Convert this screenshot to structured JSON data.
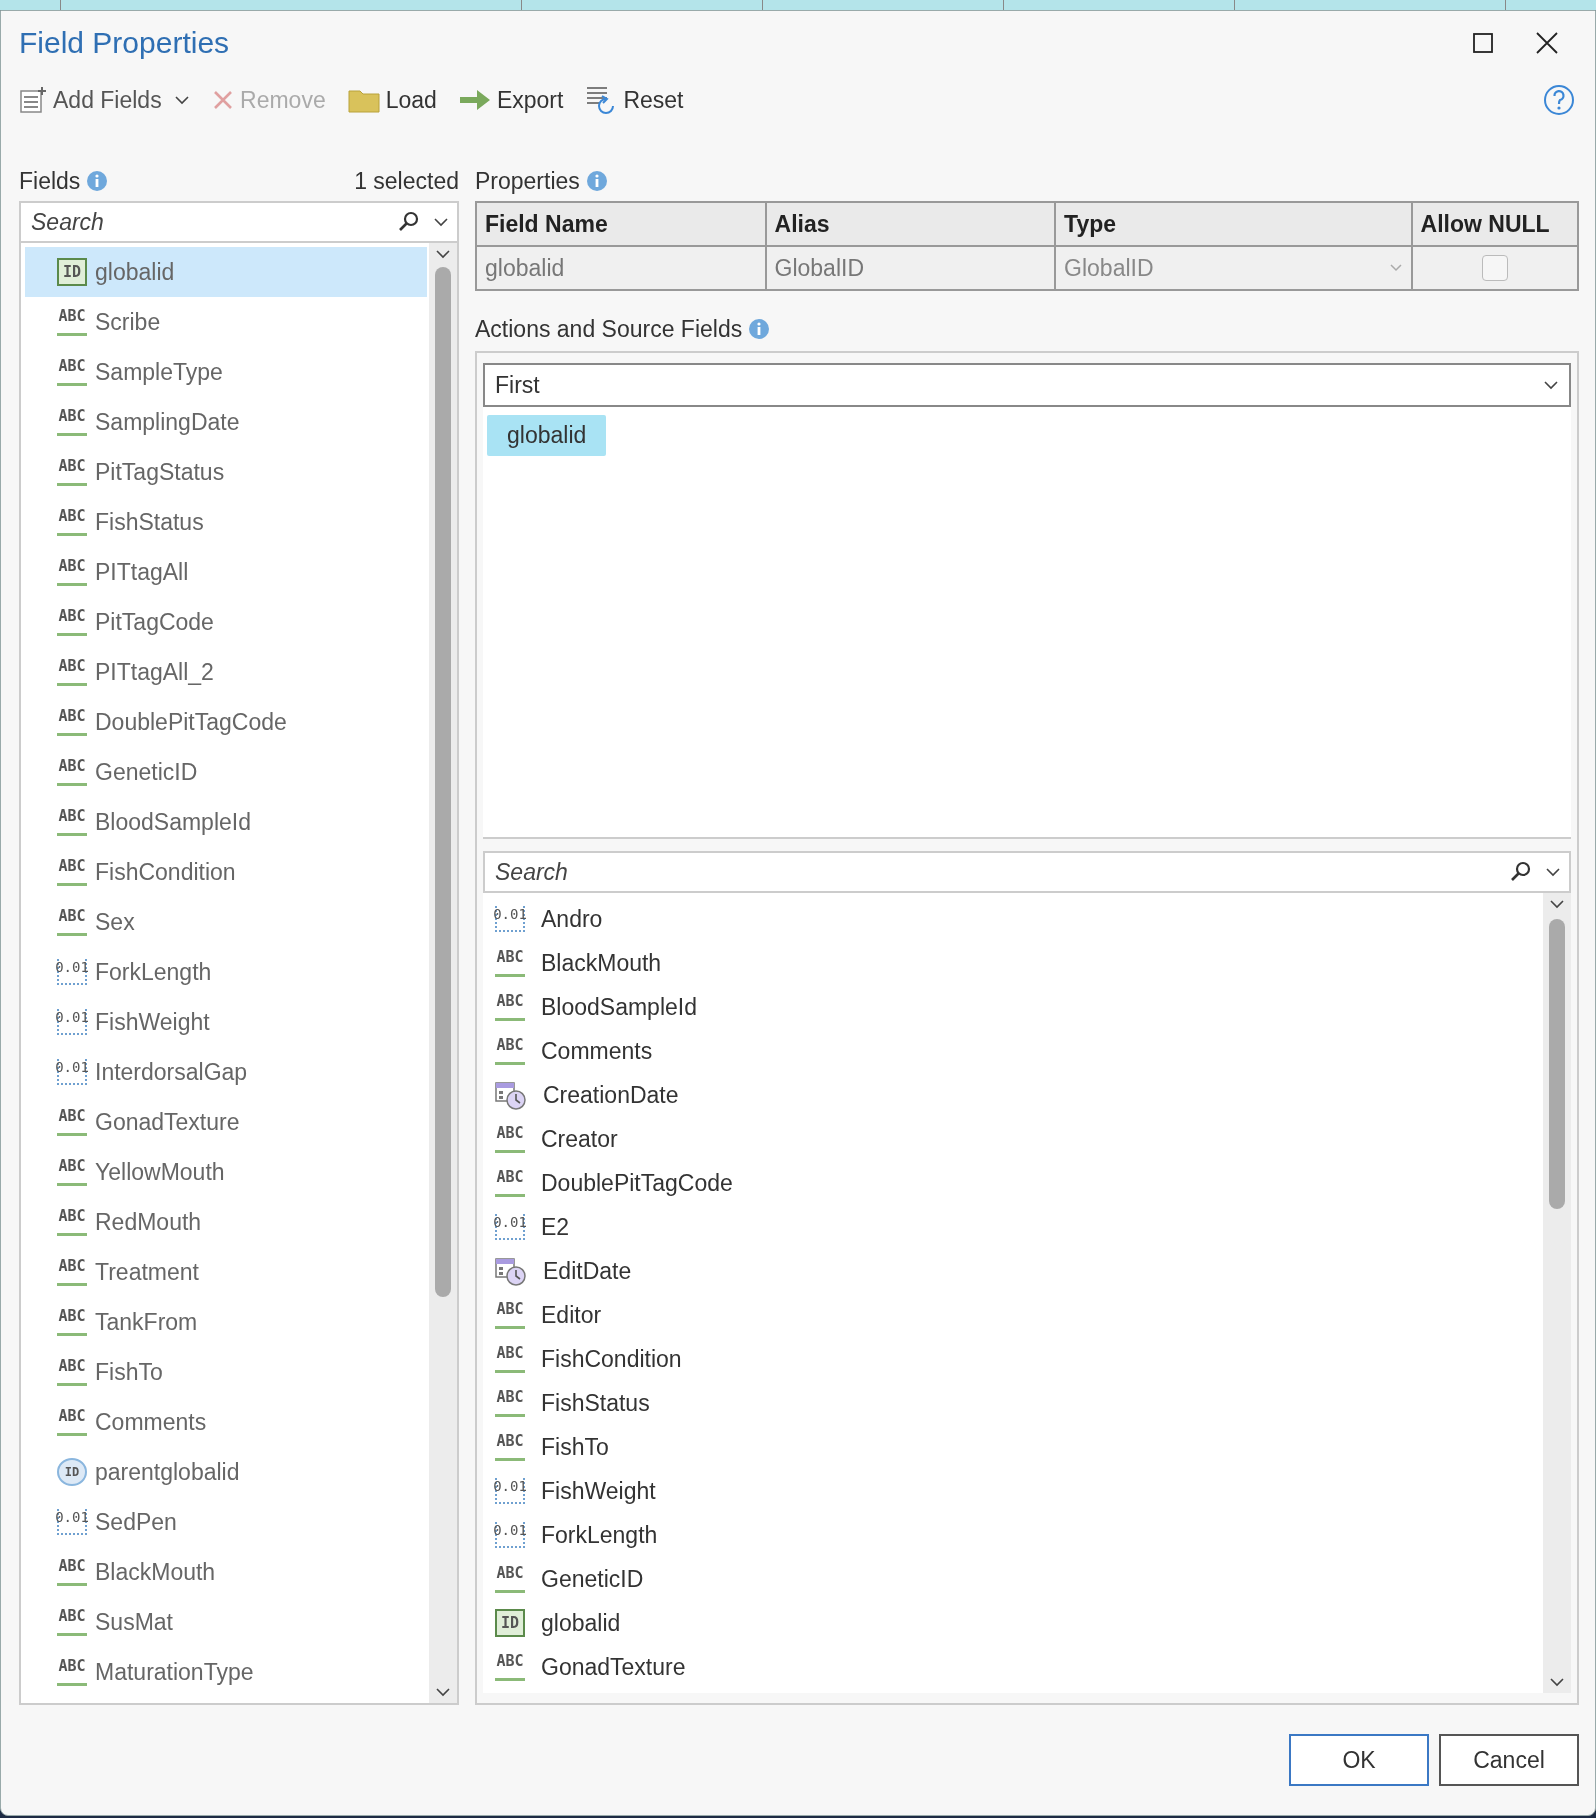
{
  "window": {
    "title": "Field Properties"
  },
  "toolbar": [
    {
      "label": "Add Fields",
      "kind": "add",
      "disabled": false,
      "dropdown": true
    },
    {
      "label": "Remove",
      "kind": "remove",
      "disabled": true,
      "dropdown": false
    },
    {
      "label": "Load",
      "kind": "load",
      "disabled": false,
      "dropdown": false
    },
    {
      "label": "Export",
      "kind": "export",
      "disabled": false,
      "dropdown": false
    },
    {
      "label": "Reset",
      "kind": "reset",
      "disabled": false,
      "dropdown": false
    }
  ],
  "fields_panel": {
    "title": "Fields",
    "count": "1 selected",
    "search": {
      "placeholder": "Search"
    },
    "items": [
      {
        "name": "globalid",
        "kind": "id",
        "icon_text": "ID",
        "selected": true
      },
      {
        "name": "Scribe",
        "kind": "text",
        "icon_text": "ABC",
        "selected": false
      },
      {
        "name": "SampleType",
        "kind": "text",
        "icon_text": "ABC",
        "selected": false
      },
      {
        "name": "SamplingDate",
        "kind": "text",
        "icon_text": "ABC",
        "selected": false
      },
      {
        "name": "PitTagStatus",
        "kind": "text",
        "icon_text": "ABC",
        "selected": false
      },
      {
        "name": "FishStatus",
        "kind": "text",
        "icon_text": "ABC",
        "selected": false
      },
      {
        "name": "PITtagAll",
        "kind": "text",
        "icon_text": "ABC",
        "selected": false
      },
      {
        "name": "PitTagCode",
        "kind": "text",
        "icon_text": "ABC",
        "selected": false
      },
      {
        "name": "PITtagAll_2",
        "kind": "text",
        "icon_text": "ABC",
        "selected": false
      },
      {
        "name": "DoublePitTagCode",
        "kind": "text",
        "icon_text": "ABC",
        "selected": false
      },
      {
        "name": "GeneticID",
        "kind": "text",
        "icon_text": "ABC",
        "selected": false
      },
      {
        "name": "BloodSampleId",
        "kind": "text",
        "icon_text": "ABC",
        "selected": false
      },
      {
        "name": "FishCondition",
        "kind": "text",
        "icon_text": "ABC",
        "selected": false
      },
      {
        "name": "Sex",
        "kind": "text",
        "icon_text": "ABC",
        "selected": false
      },
      {
        "name": "ForkLength",
        "kind": "number",
        "icon_text": "0.01",
        "selected": false
      },
      {
        "name": "FishWeight",
        "kind": "number",
        "icon_text": "0.01",
        "selected": false
      },
      {
        "name": "InterdorsalGap",
        "kind": "number",
        "icon_text": "0.01",
        "selected": false
      },
      {
        "name": "GonadTexture",
        "kind": "text",
        "icon_text": "ABC",
        "selected": false
      },
      {
        "name": "YellowMouth",
        "kind": "text",
        "icon_text": "ABC",
        "selected": false
      },
      {
        "name": "RedMouth",
        "kind": "text",
        "icon_text": "ABC",
        "selected": false
      },
      {
        "name": "Treatment",
        "kind": "text",
        "icon_text": "ABC",
        "selected": false
      },
      {
        "name": "TankFrom",
        "kind": "text",
        "icon_text": "ABC",
        "selected": false
      },
      {
        "name": "FishTo",
        "kind": "text",
        "icon_text": "ABC",
        "selected": false
      },
      {
        "name": "Comments",
        "kind": "text",
        "icon_text": "ABC",
        "selected": false
      },
      {
        "name": "parentglobalid",
        "kind": "guid",
        "icon_text": "ID",
        "selected": false
      },
      {
        "name": "SedPen",
        "kind": "number",
        "icon_text": "0.01",
        "selected": false
      },
      {
        "name": "BlackMouth",
        "kind": "text",
        "icon_text": "ABC",
        "selected": false
      },
      {
        "name": "SusMat",
        "kind": "text",
        "icon_text": "ABC",
        "selected": false
      },
      {
        "name": "MaturationType",
        "kind": "text",
        "icon_text": "ABC",
        "selected": false
      }
    ]
  },
  "properties": {
    "title": "Properties",
    "columns": [
      "Field Name",
      "Alias",
      "Type",
      "Allow NULL"
    ],
    "row": {
      "field_name": "globalid",
      "alias": "GlobalID",
      "type": "GlobalID",
      "allow_null": false,
      "disabled": true
    }
  },
  "actions": {
    "title": "Actions and Source Fields",
    "action": "First",
    "chips": [
      "globalid"
    ],
    "search": {
      "placeholder": "Search"
    },
    "source_fields": [
      {
        "name": "Andro",
        "kind": "number",
        "icon_text": "0.01"
      },
      {
        "name": "BlackMouth",
        "kind": "text",
        "icon_text": "ABC"
      },
      {
        "name": "BloodSampleId",
        "kind": "text",
        "icon_text": "ABC"
      },
      {
        "name": "Comments",
        "kind": "text",
        "icon_text": "ABC"
      },
      {
        "name": "CreationDate",
        "kind": "date"
      },
      {
        "name": "Creator",
        "kind": "text",
        "icon_text": "ABC"
      },
      {
        "name": "DoublePitTagCode",
        "kind": "text",
        "icon_text": "ABC"
      },
      {
        "name": "E2",
        "kind": "number",
        "icon_text": "0.01"
      },
      {
        "name": "EditDate",
        "kind": "date"
      },
      {
        "name": "Editor",
        "kind": "text",
        "icon_text": "ABC"
      },
      {
        "name": "FishCondition",
        "kind": "text",
        "icon_text": "ABC"
      },
      {
        "name": "FishStatus",
        "kind": "text",
        "icon_text": "ABC"
      },
      {
        "name": "FishTo",
        "kind": "text",
        "icon_text": "ABC"
      },
      {
        "name": "FishWeight",
        "kind": "number",
        "icon_text": "0.01"
      },
      {
        "name": "ForkLength",
        "kind": "number",
        "icon_text": "0.01"
      },
      {
        "name": "GeneticID",
        "kind": "text",
        "icon_text": "ABC"
      },
      {
        "name": "globalid",
        "kind": "id",
        "icon_text": "ID"
      },
      {
        "name": "GonadTexture",
        "kind": "text",
        "icon_text": "ABC"
      }
    ]
  },
  "buttons": [
    {
      "label": "OK",
      "default": true
    },
    {
      "label": "Cancel",
      "default": false
    }
  ]
}
